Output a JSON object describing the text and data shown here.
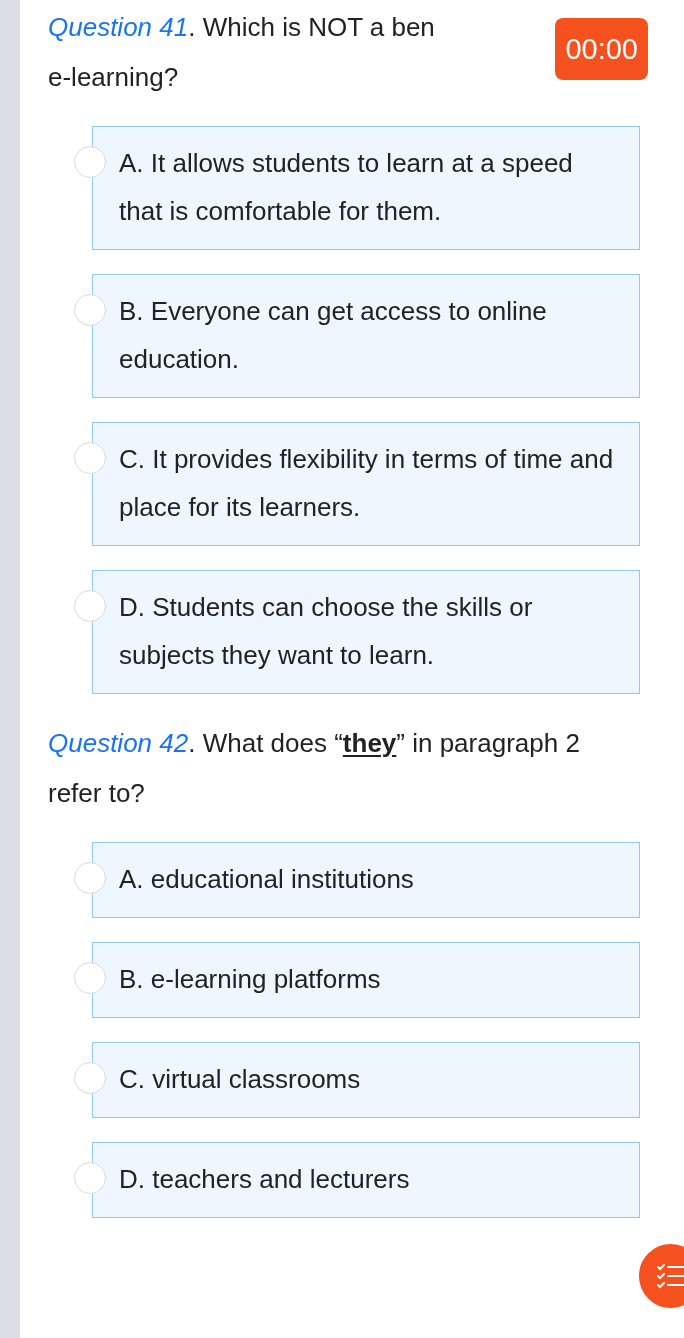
{
  "timer": "00:00",
  "questions": [
    {
      "label": "Question 41",
      "prompt_lines": [
        ". Which is NOT a ben",
        "e-learning?"
      ],
      "options": [
        {
          "text": "A. It allows students to learn at a speed that is comfortable for them.",
          "selected": false
        },
        {
          "text": "B. Everyone can get access to online education.",
          "selected": false
        },
        {
          "text": "C. It provides flexibility in terms of time and place for its learners.",
          "selected": false
        },
        {
          "text": "D. Students can choose the skills or subjects they want to learn.",
          "selected": false
        }
      ]
    },
    {
      "label": "Question 42",
      "prompt_before": ". What does “",
      "underlined": "they",
      "prompt_after": "” in paragraph 2 refer to?",
      "options": [
        {
          "text": "A. educational institutions",
          "selected": false
        },
        {
          "text": "B. e-learning platforms",
          "selected": false
        },
        {
          "text": "C. virtual classrooms",
          "selected": false
        },
        {
          "text": "D. teachers and lecturers",
          "selected": false
        }
      ]
    }
  ]
}
